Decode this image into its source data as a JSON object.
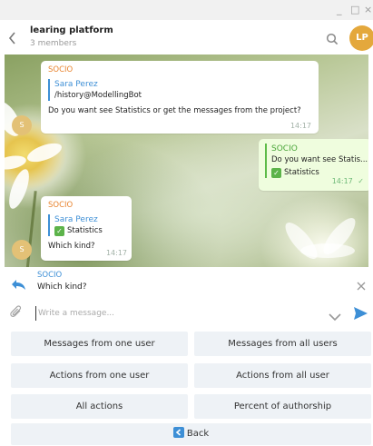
{
  "window": {
    "controls": [
      "_",
      "□",
      "×"
    ]
  },
  "header": {
    "title": "learing platform",
    "subtitle": "3 members",
    "avatar": "LP"
  },
  "messages": [
    {
      "sender": "SOCIO",
      "reply_name": "Sara Perez",
      "reply_text": "/history@ModellingBot",
      "text": "Do you want see Statistics or get the messages from the project?",
      "time": "14:17",
      "avatar": "S"
    },
    {
      "sender": "SOCIO",
      "reply_text": "Do you want see Statis...",
      "text": "Statistics",
      "time": "14:17"
    },
    {
      "sender": "SOCIO",
      "reply_name": "Sara Perez",
      "reply_text": "Statistics",
      "text": "Which kind?",
      "time": "14:17",
      "avatar": "S"
    }
  ],
  "reply_bar": {
    "name": "SOCIO",
    "text": "Which kind?"
  },
  "composer": {
    "placeholder": "Write a message..."
  },
  "keyboard": {
    "rows": [
      [
        "Messages from one user",
        "Messages from all users"
      ],
      [
        "Actions from one user",
        "Actions from all user"
      ],
      [
        "All actions",
        "Percent of authorship"
      ]
    ],
    "back": "Back"
  },
  "colors": {
    "accent": "#3d8fd6",
    "sender": "#e8832e",
    "avatar": "#e4a83c",
    "outgoing": "#effdde",
    "keyboard_button": "#eef2f6"
  },
  "icons": [
    "back-arrow-icon",
    "search-icon",
    "reply-arrow-icon",
    "close-icon",
    "paperclip-icon",
    "chevron-down-icon",
    "send-icon",
    "check-icon",
    "back-square-icon"
  ]
}
